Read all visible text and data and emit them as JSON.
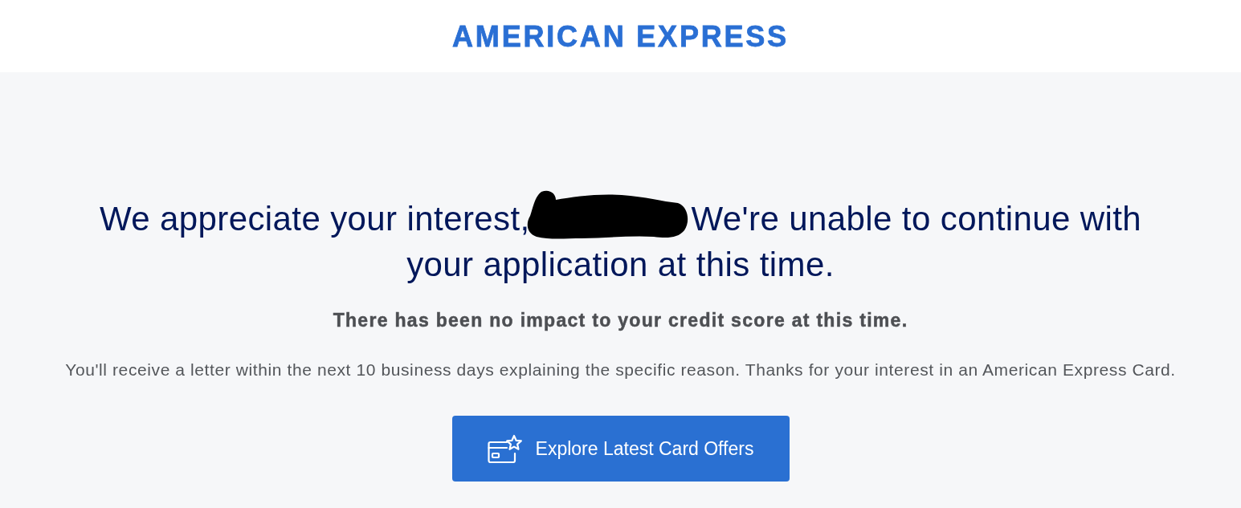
{
  "header": {
    "logo": "AMERICAN EXPRESS"
  },
  "heading": {
    "before_redaction": "We appreciate your interest,",
    "redacted": true,
    "after_redaction": "We're unable to continue with your application at this time."
  },
  "notice": "There has been no impact to your credit score at this time.",
  "message": "You'll receive a letter within the next 10 business days explaining the specific reason. Thanks for your interest in an American Express Card.",
  "button": {
    "label": "Explore Latest Card Offers"
  }
}
